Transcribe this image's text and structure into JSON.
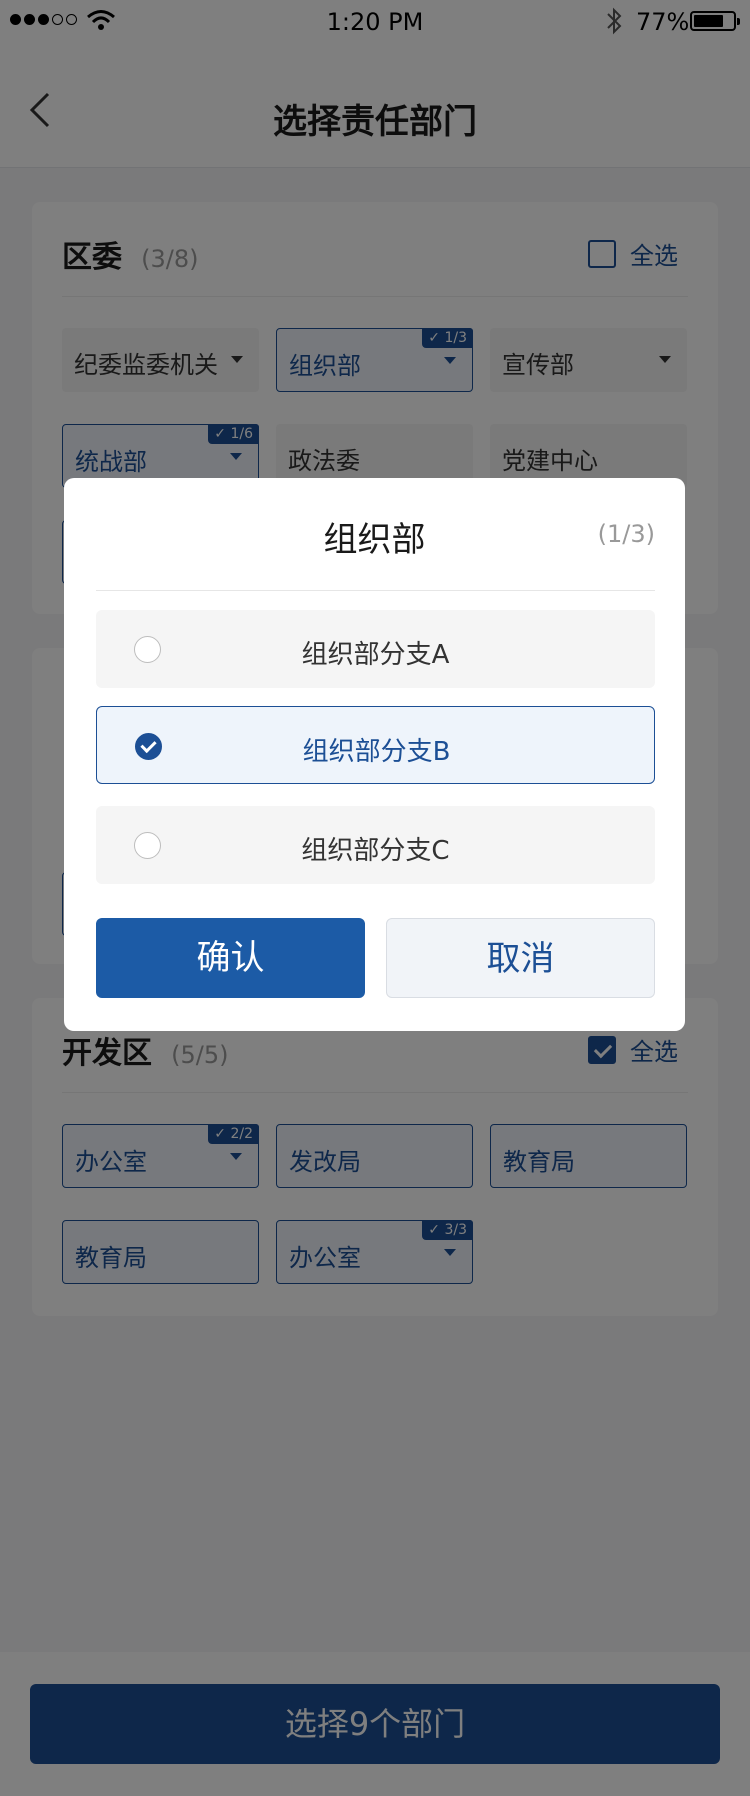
{
  "status_bar": {
    "time": "1:20 PM",
    "battery": "77%",
    "battery_level": 0.77
  },
  "nav": {
    "title": "选择责任部门"
  },
  "cards": [
    {
      "title": "区委",
      "count": "(3/8)",
      "select_all_label": "全选",
      "select_all_checked": false,
      "chips": [
        {
          "label": "纪委监委机关",
          "dropdown": true,
          "selected": false,
          "badge": ""
        },
        {
          "label": "组织部",
          "dropdown": true,
          "selected": true,
          "badge": "1/3"
        },
        {
          "label": "宣传部",
          "dropdown": true,
          "selected": false,
          "badge": ""
        },
        {
          "label": "统战部",
          "dropdown": true,
          "selected": true,
          "badge": "1/6"
        },
        {
          "label": "政法委",
          "dropdown": false,
          "selected": false,
          "badge": ""
        },
        {
          "label": "党建中心",
          "dropdown": false,
          "selected": false,
          "badge": ""
        }
      ]
    },
    {
      "title": "开发区",
      "count": "(5/5)",
      "select_all_label": "全选",
      "select_all_checked": true,
      "chips": [
        {
          "label": "办公室",
          "dropdown": true,
          "selected": true,
          "badge": "2/2"
        },
        {
          "label": "发改局",
          "dropdown": false,
          "selected": true,
          "badge": ""
        },
        {
          "label": "教育局",
          "dropdown": false,
          "selected": true,
          "badge": ""
        },
        {
          "label": "教育局",
          "dropdown": false,
          "selected": true,
          "badge": ""
        },
        {
          "label": "办公室",
          "dropdown": true,
          "selected": true,
          "badge": "3/3"
        }
      ]
    }
  ],
  "bottom": {
    "confirm_label": "选择9个部门"
  },
  "modal": {
    "title": "组织部",
    "count": "(1/3)",
    "options": [
      {
        "label": "组织部分支A",
        "checked": false
      },
      {
        "label": "组织部分支B",
        "checked": true
      },
      {
        "label": "组织部分支C",
        "checked": false
      }
    ],
    "confirm_label": "确认",
    "cancel_label": "取消"
  },
  "colors": {
    "accent": "#1c4f95",
    "primary_button": "#1c5ba6",
    "overlay": "rgba(0,0,0,0.5)"
  }
}
